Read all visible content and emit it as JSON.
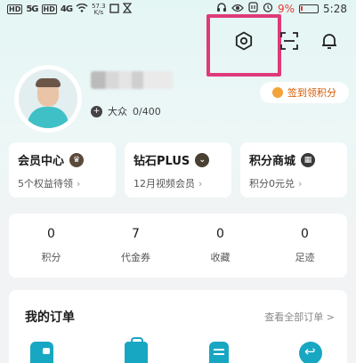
{
  "status_bar": {
    "hd1": "HD",
    "signal1": "5G",
    "hd2": "HD",
    "signal2": "4G",
    "net_speed_value": "57.3",
    "net_speed_unit": "K/s",
    "battery_percent": "9%",
    "time": "5:28"
  },
  "profile": {
    "level_name": "大众",
    "level_progress": "0/400"
  },
  "checkin": {
    "label": "签到领积分"
  },
  "cards": [
    {
      "title": "会员中心",
      "subtitle": "5个权益待领",
      "badge_color": "#5a4a3c"
    },
    {
      "title": "钻石PLUS",
      "subtitle": "12月视频会员",
      "badge_color": "#4a4032"
    },
    {
      "title": "积分商城",
      "subtitle": "积分0元兑",
      "badge_color": "#3a3a3a"
    }
  ],
  "stats": [
    {
      "value": "0",
      "label": "积分"
    },
    {
      "value": "7",
      "label": "代金券"
    },
    {
      "value": "0",
      "label": "收藏"
    },
    {
      "value": "0",
      "label": "足迹"
    }
  ],
  "orders": {
    "title": "我的订单",
    "view_all": "查看全部订单 >"
  },
  "colors": {
    "accent_highlight": "#e0397a",
    "brand_teal": "#17a7c2",
    "checkin_orange": "#d45a00"
  },
  "icons": {
    "settings": "gear-hexagon-icon",
    "scan": "scan-icon",
    "notification": "bell-icon"
  }
}
